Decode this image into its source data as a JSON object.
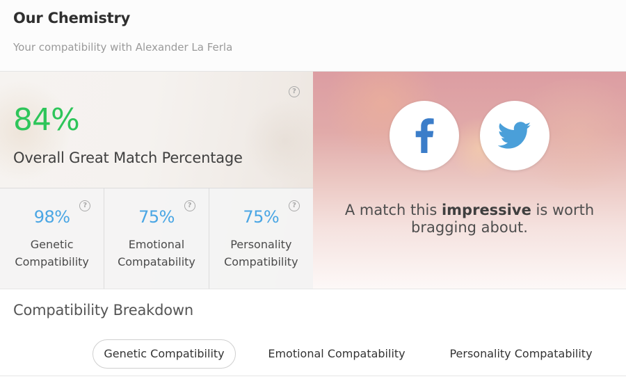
{
  "header": {
    "title": "Our Chemistry",
    "subtitle": "Your compatibility with Alexander La Ferla"
  },
  "overall": {
    "percentage": "84%",
    "label": "Overall Great Match Percentage",
    "help_glyph": "?"
  },
  "stats": [
    {
      "percentage": "98%",
      "label_line1": "Genetic",
      "label_line2": "Compatibility",
      "help_glyph": "?"
    },
    {
      "percentage": "75%",
      "label_line1": "Emotional",
      "label_line2": "Compatability",
      "help_glyph": "?"
    },
    {
      "percentage": "75%",
      "label_line1": "Personality",
      "label_line2": "Compatibility",
      "help_glyph": "?"
    }
  ],
  "share": {
    "icons": [
      "facebook-icon",
      "twitter-icon"
    ],
    "message_before": "A match this ",
    "message_emphasis": "impressive",
    "message_after": " is worth bragging about."
  },
  "breakdown": {
    "title": "Compatibility Breakdown",
    "tabs": [
      {
        "label": "Genetic Compatibility",
        "active": true
      },
      {
        "label": "Emotional Compatability",
        "active": false
      },
      {
        "label": "Personality Compatability",
        "active": false
      }
    ]
  },
  "colors": {
    "overall_green": "#2ec55a",
    "stat_blue": "#4aa6e4",
    "facebook_blue": "#3b7dc9",
    "twitter_blue": "#4a9fd9"
  }
}
